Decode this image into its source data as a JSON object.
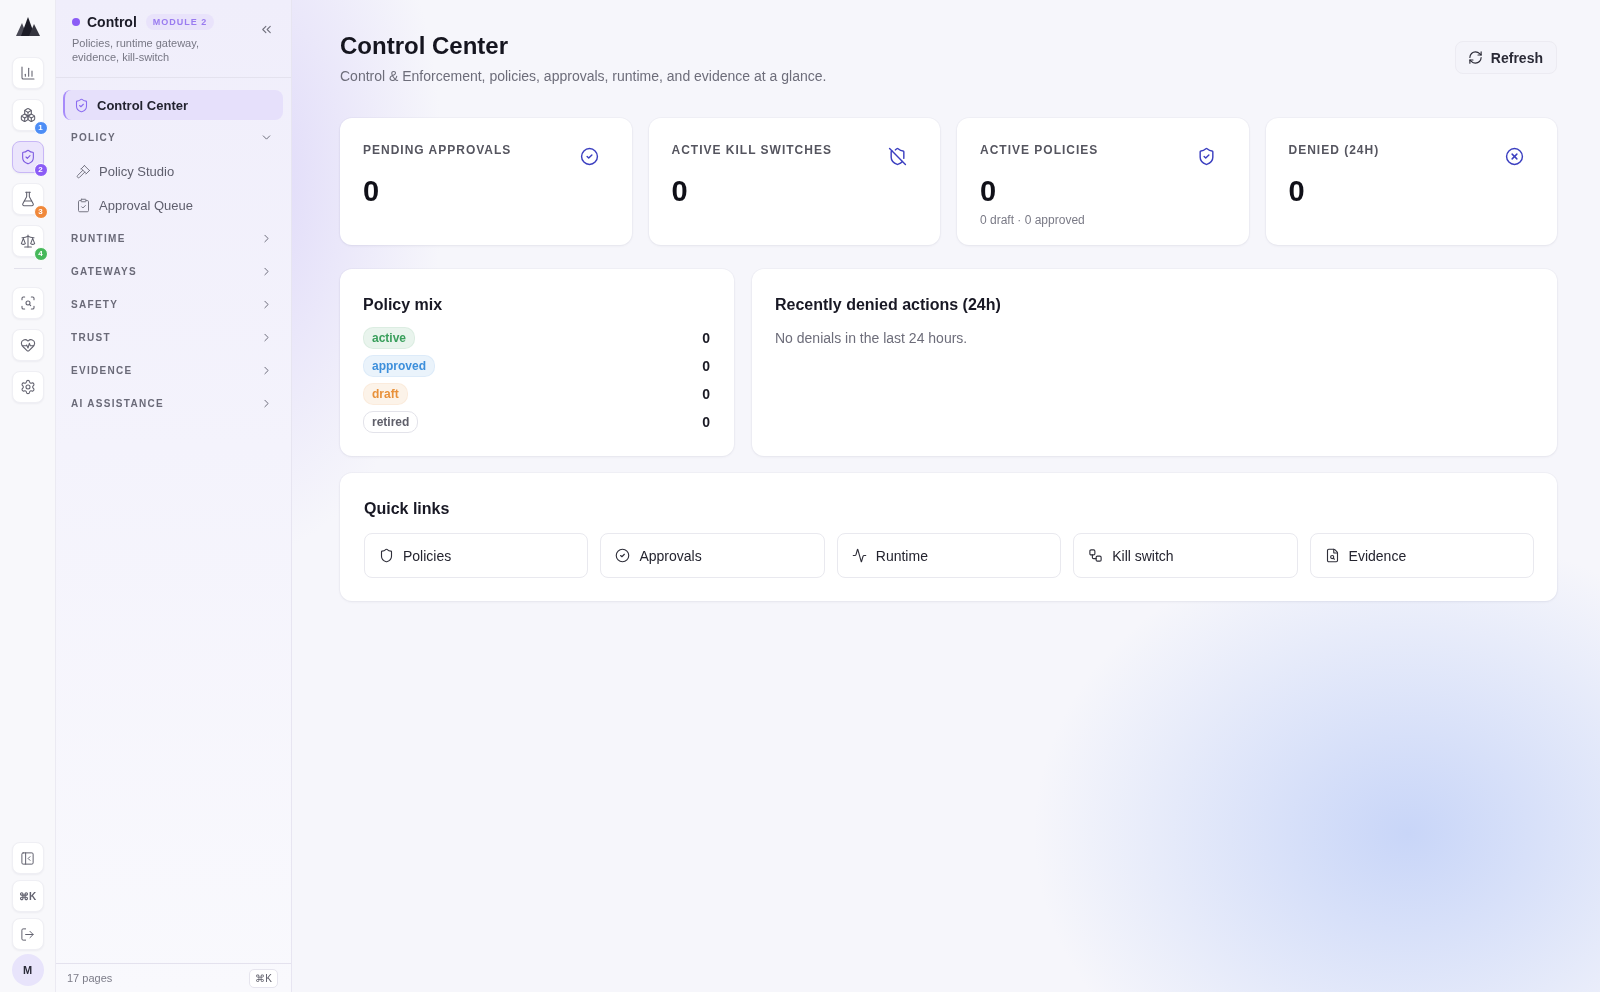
{
  "rail": {
    "modules": [
      {
        "selected": false
      },
      {
        "selected": false,
        "badge": "1",
        "color": "#4c8df6"
      },
      {
        "selected": true,
        "badge": "2",
        "color": "#8b5cf6"
      },
      {
        "selected": false,
        "badge": "3",
        "color": "#f0883a"
      },
      {
        "selected": false,
        "badge": "4",
        "color": "#46b85a"
      }
    ],
    "tools": [
      {
        "selected": false
      },
      {
        "selected": false
      },
      {
        "selected": false
      }
    ],
    "footer": [
      {
        "kind": "icon"
      },
      {
        "kind": "text",
        "label": "⌘K"
      },
      {
        "kind": "icon"
      }
    ],
    "avatar": "M"
  },
  "sidebar": {
    "module": {
      "name": "Control",
      "tag": "MODULE 2",
      "description": "Policies, runtime gateway, evidence, kill-switch"
    },
    "nav": [
      {
        "kind": "link",
        "label": "Control Center",
        "selected": true
      },
      {
        "kind": "section",
        "label": "POLICY",
        "expanded": true,
        "children": [
          {
            "label": "Policy Studio",
            "selected": false
          },
          {
            "label": "Approval Queue",
            "selected": false
          }
        ]
      },
      {
        "kind": "section",
        "label": "RUNTIME",
        "expanded": false
      },
      {
        "kind": "section",
        "label": "GATEWAYS",
        "expanded": false
      },
      {
        "kind": "section",
        "label": "SAFETY",
        "expanded": false
      },
      {
        "kind": "section",
        "label": "TRUST",
        "expanded": false
      },
      {
        "kind": "section",
        "label": "EVIDENCE",
        "expanded": false
      },
      {
        "kind": "section",
        "label": "AI ASSISTANCE",
        "expanded": false
      }
    ],
    "footer": {
      "count": "17 pages",
      "shortcut": "⌘K"
    }
  },
  "header": {
    "title": "Control Center",
    "subtitle": "Control & Enforcement, policies, approvals, runtime, and evidence at a glance.",
    "refresh": "Refresh"
  },
  "stats": [
    {
      "label": "PENDING APPROVALS",
      "value": "0"
    },
    {
      "label": "ACTIVE KILL SWITCHES",
      "value": "0"
    },
    {
      "label": "ACTIVE POLICIES",
      "value": "0",
      "note": "0 draft · 0 approved"
    },
    {
      "label": "DENIED (24H)",
      "value": "0"
    }
  ],
  "policy_mix": {
    "title": "Policy mix",
    "rows": [
      {
        "status": "active",
        "count": "0",
        "color": "#3a9f5c",
        "outlined": false
      },
      {
        "status": "approved",
        "count": "0",
        "color": "#3d8fdb",
        "outlined": false
      },
      {
        "status": "draft",
        "count": "0",
        "color": "#e8913a",
        "outlined": false
      },
      {
        "status": "retired",
        "count": "0",
        "color": "#5f5f6a",
        "outlined": true
      }
    ]
  },
  "denied": {
    "title": "Recently denied actions (24h)",
    "empty": "No denials in the last 24 hours."
  },
  "quick_links": {
    "title": "Quick links",
    "links": [
      {
        "label": "Policies"
      },
      {
        "label": "Approvals"
      },
      {
        "label": "Runtime"
      },
      {
        "label": "Kill switch"
      },
      {
        "label": "Evidence"
      }
    ]
  }
}
